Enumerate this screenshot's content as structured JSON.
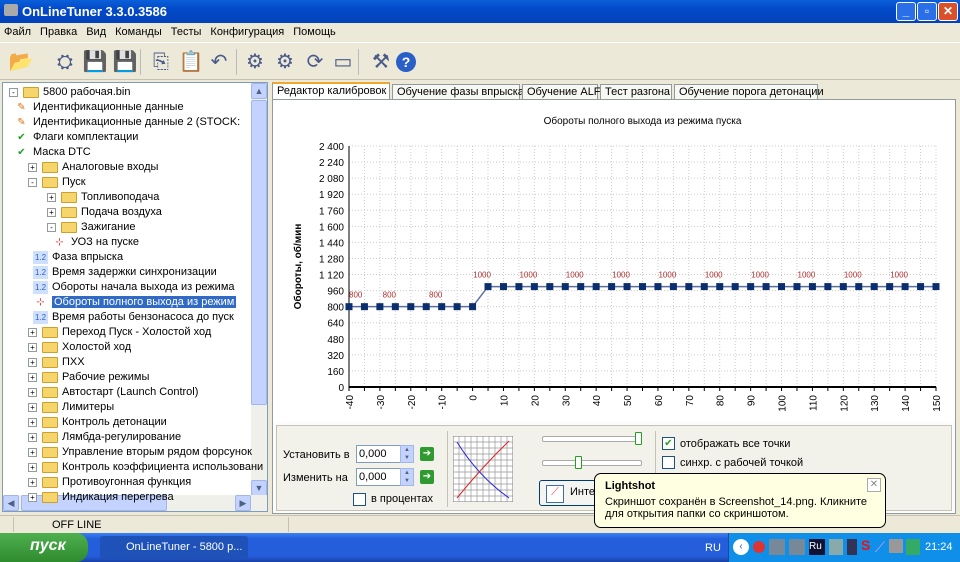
{
  "window": {
    "title": "OnLineTuner 3.3.0.3586"
  },
  "menu": [
    "Файл",
    "Правка",
    "Вид",
    "Команды",
    "Тесты",
    "Конфигурация",
    "Помощь"
  ],
  "toolbar": [
    "open-icon",
    "read-ecu-icon",
    "save-icon",
    "save-as-icon",
    "copy-icon",
    "paste-icon",
    "undo-icon",
    "connect-icon",
    "disconnect-icon",
    "refresh-icon",
    "engine-icon",
    "tools-icon",
    "help-icon"
  ],
  "tree": [
    {
      "label": "5800 рабочая.bin",
      "level": 0,
      "type": "folder",
      "expander": "-"
    },
    {
      "label": "Идентификационные данные",
      "level": 1,
      "type": "edit"
    },
    {
      "label": "Идентификационные данные 2 (STOCK:",
      "level": 1,
      "type": "edit"
    },
    {
      "label": "Флаги комплектации",
      "level": 1,
      "type": "check"
    },
    {
      "label": "Маска DTC",
      "level": 1,
      "type": "check"
    },
    {
      "label": "Аналоговые входы",
      "level": 1,
      "type": "folder",
      "expander": "+"
    },
    {
      "label": "Пуск",
      "level": 1,
      "type": "folder",
      "expander": "-"
    },
    {
      "label": "Топливоподача",
      "level": 2,
      "type": "folder",
      "expander": "+"
    },
    {
      "label": "Подача воздуха",
      "level": 2,
      "type": "folder",
      "expander": "+"
    },
    {
      "label": "Зажигание",
      "level": 2,
      "type": "folder",
      "expander": "-"
    },
    {
      "label": "УОЗ на пуске",
      "level": 3,
      "type": "chart"
    },
    {
      "label": "Фаза впрыска",
      "level": 2,
      "type": "value"
    },
    {
      "label": "Время задержки синхронизации",
      "level": 2,
      "type": "value"
    },
    {
      "label": "Обороты начала выхода из режима",
      "level": 2,
      "type": "value"
    },
    {
      "label": "Обороты полного выхода из режим",
      "level": 2,
      "type": "chart",
      "selected": true
    },
    {
      "label": "Время работы бензонасоса до пуск",
      "level": 2,
      "type": "value"
    },
    {
      "label": "Переход Пуск - Холостой ход",
      "level": 1,
      "type": "folder",
      "expander": "+"
    },
    {
      "label": "Холостой ход",
      "level": 1,
      "type": "folder",
      "expander": "+"
    },
    {
      "label": "ПХХ",
      "level": 1,
      "type": "folder",
      "expander": "+"
    },
    {
      "label": "Рабочие режимы",
      "level": 1,
      "type": "folder",
      "expander": "+"
    },
    {
      "label": "Автостарт (Launch Control)",
      "level": 1,
      "type": "folder",
      "expander": "+"
    },
    {
      "label": "Лимитеры",
      "level": 1,
      "type": "folder",
      "expander": "+"
    },
    {
      "label": "Контроль детонации",
      "level": 1,
      "type": "folder",
      "expander": "+"
    },
    {
      "label": "Лямбда-регулирование",
      "level": 1,
      "type": "folder",
      "expander": "+"
    },
    {
      "label": "Управление вторым рядом форсунок",
      "level": 1,
      "type": "folder",
      "expander": "+"
    },
    {
      "label": "Контроль коэффициента использовани",
      "level": 1,
      "type": "folder",
      "expander": "+"
    },
    {
      "label": "Противоугонная функция",
      "level": 1,
      "type": "folder",
      "expander": "+"
    },
    {
      "label": "Индикация перегрева",
      "level": 1,
      "type": "folder",
      "expander": "+"
    }
  ],
  "tabs": [
    {
      "label": "Редактор калибровок",
      "active": true
    },
    {
      "label": "Обучение фазы впрыска"
    },
    {
      "label": "Обучение ALF"
    },
    {
      "label": "Тест разгона"
    },
    {
      "label": "Обучение порога детонации"
    }
  ],
  "chart_data": {
    "type": "line",
    "title": "Обороты полного выхода из режима пуска",
    "ylabel": "Обороты, об/мин",
    "xlabel": "",
    "xlim": [
      -40,
      150
    ],
    "ylim": [
      0,
      2400
    ],
    "xticks": [
      -40,
      -30,
      -20,
      -10,
      0,
      10,
      20,
      30,
      40,
      50,
      60,
      70,
      80,
      90,
      100,
      110,
      120,
      130,
      140,
      150
    ],
    "yticks": [
      "0",
      "160",
      "320",
      "480",
      "640",
      "800",
      "960",
      "1 120",
      "1 280",
      "1 440",
      "1 600",
      "1 760",
      "1 920",
      "2 080",
      "2 240",
      "2 400"
    ],
    "grid": true,
    "x": [
      -40,
      -35,
      -30,
      -25,
      -20,
      -15,
      -10,
      -5,
      0,
      5,
      10,
      15,
      20,
      25,
      30,
      35,
      40,
      45,
      50,
      55,
      60,
      65,
      70,
      75,
      80,
      85,
      90,
      95,
      100,
      105,
      110,
      115,
      120,
      125,
      130,
      135,
      140,
      145,
      150
    ],
    "values": [
      800,
      800,
      800,
      800,
      800,
      800,
      800,
      800,
      800,
      1000,
      1000,
      1000,
      1000,
      1000,
      1000,
      1000,
      1000,
      1000,
      1000,
      1000,
      1000,
      1000,
      1000,
      1000,
      1000,
      1000,
      1000,
      1000,
      1000,
      1000,
      1000,
      1000,
      1000,
      1000,
      1000,
      1000,
      1000,
      1000,
      1000
    ],
    "line_color": "#5a6e9a",
    "marker_color": "#0a2e6e",
    "label_color": "#b03030"
  },
  "editor": {
    "set_label": "Установить в",
    "set_value": "0,000",
    "change_label": "Изменить на",
    "change_value": "0,000",
    "percent_label": "в процентах",
    "percent_checked": false,
    "interp_label": "Инте",
    "slider1": 1.0,
    "slider2": 0.35,
    "show_all_label": "отображать все точки",
    "show_all_checked": true,
    "sync_label": "синхр. с рабочей точкой",
    "sync_checked": false
  },
  "status": {
    "connection": "OFF LINE"
  },
  "taskbar": {
    "start": "пуск",
    "task": "OnLineTuner - 5800 р...",
    "lang": "RU",
    "clock": "21:24"
  },
  "balloon": {
    "title": "Lightshot",
    "text": "Скриншот сохранён в Screenshot_14.png. Кликните для открытия папки со скриншотом."
  }
}
